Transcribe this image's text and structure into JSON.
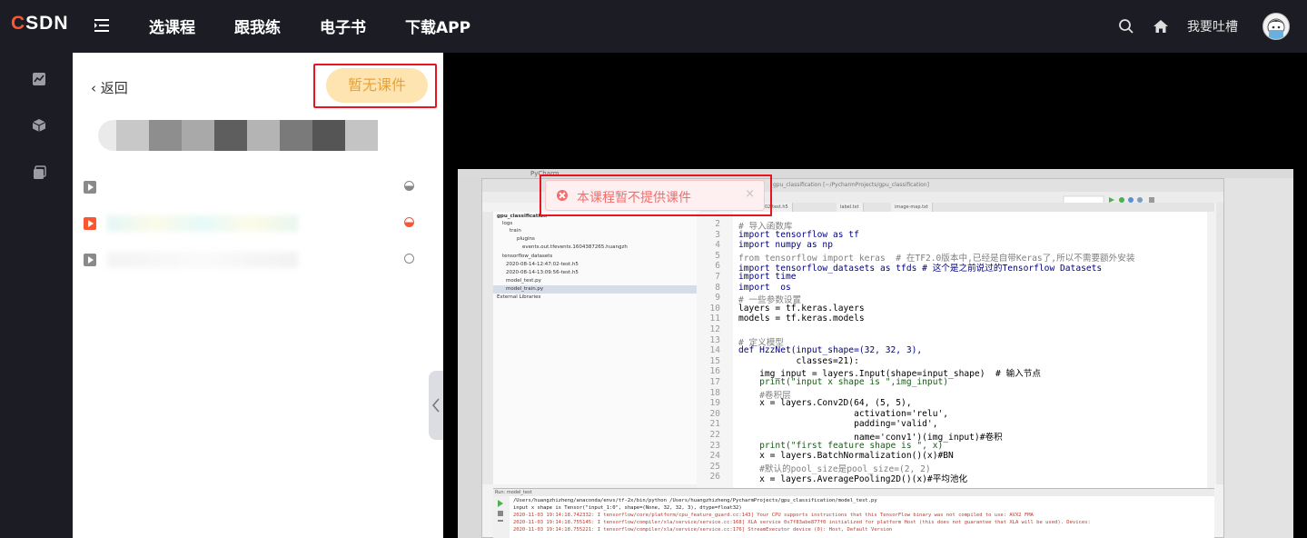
{
  "topbar": {
    "logo_c": "C",
    "logo_rest": "SDN",
    "nav": [
      "选课程",
      "跟我练",
      "电子书",
      "下载APP"
    ],
    "feedback": "我要吐槽"
  },
  "rail": {
    "icons": [
      "chart-icon",
      "cube-icon",
      "copy-icon"
    ]
  },
  "panel": {
    "back_label": "返回",
    "no_courseware_label": "暂无课件",
    "chapters": [
      {
        "active": false,
        "status": "half"
      },
      {
        "active": true,
        "status": "half-active"
      },
      {
        "active": false,
        "status": "empty"
      }
    ]
  },
  "toast": {
    "message": "本课程暂不提供课件",
    "close": "×"
  },
  "video": {
    "mac_bar_app": "PyCharm",
    "ide_title": "gpu_classification [~/PycharmProjects/gpu_classification]",
    "ide_tabs": [
      "2020-08-14-12:47:02-test.h5",
      "label.txt",
      "image-map.txt"
    ],
    "project_tree": [
      "gpu_classification",
      "logs",
      "train",
      "plugins",
      "events.out.tfevents.1604387265.huangzh",
      "tensorflow_datasets",
      "2020-08-14-12:47:02-test.h5",
      "2020-08-14-13:09:56-test.h5",
      "model_test.py",
      "model_train.py",
      "External Libraries"
    ],
    "code_lines": [
      {
        "n": "2",
        "t": "# 导入函数库",
        "c": "cm"
      },
      {
        "n": "3",
        "t": "import tensorflow as tf",
        "c": "imp"
      },
      {
        "n": "4",
        "t": "import numpy as np",
        "c": "imp"
      },
      {
        "n": "5",
        "t": "from tensorflow import keras  # 在TF2.0版本中,已经是自带Keras了,所以不需要额外安装",
        "c": "cm"
      },
      {
        "n": "6",
        "t": "import tensorflow_datasets as tfds # 这个是之前说过的Tensorflow Datasets",
        "c": "imp"
      },
      {
        "n": "7",
        "t": "import time",
        "c": "imp"
      },
      {
        "n": "8",
        "t": "import  os",
        "c": "imp"
      },
      {
        "n": "9",
        "t": "# 一些参数设置",
        "c": "cm"
      },
      {
        "n": "10",
        "t": "layers = tf.keras.layers",
        "c": ""
      },
      {
        "n": "11",
        "t": "models = tf.keras.models",
        "c": ""
      },
      {
        "n": "12",
        "t": "",
        "c": ""
      },
      {
        "n": "13",
        "t": "# 定义模型",
        "c": "cm"
      },
      {
        "n": "14",
        "t": "def HzzNet(input_shape=(32, 32, 3),",
        "c": "def"
      },
      {
        "n": "15",
        "t": "           classes=21):",
        "c": ""
      },
      {
        "n": "16",
        "t": "    img_input = layers.Input(shape=input_shape)  # 输入节点",
        "c": ""
      },
      {
        "n": "17",
        "t": "    print(\"input x shape is \",img_input)",
        "c": "pr"
      },
      {
        "n": "18",
        "t": "    #卷积层",
        "c": "cm"
      },
      {
        "n": "19",
        "t": "    x = layers.Conv2D(64, (5, 5),",
        "c": ""
      },
      {
        "n": "20",
        "t": "                      activation='relu',",
        "c": ""
      },
      {
        "n": "21",
        "t": "                      padding='valid',",
        "c": ""
      },
      {
        "n": "22",
        "t": "                      name='conv1')(img_input)#卷积",
        "c": ""
      },
      {
        "n": "23",
        "t": "    print(\"first feature shape is \", x)",
        "c": "pr"
      },
      {
        "n": "24",
        "t": "    x = layers.BatchNormalization()(x)#BN",
        "c": ""
      },
      {
        "n": "25",
        "t": "    #默认的pool_size是pool_size=(2, 2)",
        "c": "cm"
      },
      {
        "n": "26",
        "t": "    x = layers.AveragePooling2D()(x)#平均池化",
        "c": ""
      }
    ],
    "run_title": "Run: model_test",
    "run_lines": [
      "/Users/huangzhizheng/anaconda/envs/tf-2x/bin/python /Users/huangzhizheng/PycharmProjects/gpu_classification/model_test.py",
      "input x shape is  Tensor(\"input_1:0\", shape=(None, 32, 32, 3), dtype=float32)",
      "2020-11-03 19:14:18.742332: I tensorflow/core/platform/cpu_feature_guard.cc:143] Your CPU supports instructions that this TensorFlow binary was not compiled to use: AVX2 FMA",
      "2020-11-03 19:14:18.755145: I tensorflow/compiler/xla/service/service.cc:168] XLA service 0x7f83abe877f0 initialized for platform Host (this does not guarantee that XLA will be used). Devices:",
      "2020-11-03 19:14:18.755221: I tensorflow/compiler/xla/service/service.cc:176]   StreamExecutor device (0): Host, Default Version"
    ]
  },
  "colors": {
    "brand_red": "#fc5531",
    "highlight_box": "#e8141f",
    "nocourse_bg": "#fde4b0",
    "nocourse_text": "#e8a23a",
    "toast_text": "#f56c6c",
    "chapter_active": "#fc5531",
    "chapter_inactive": "#999999"
  }
}
